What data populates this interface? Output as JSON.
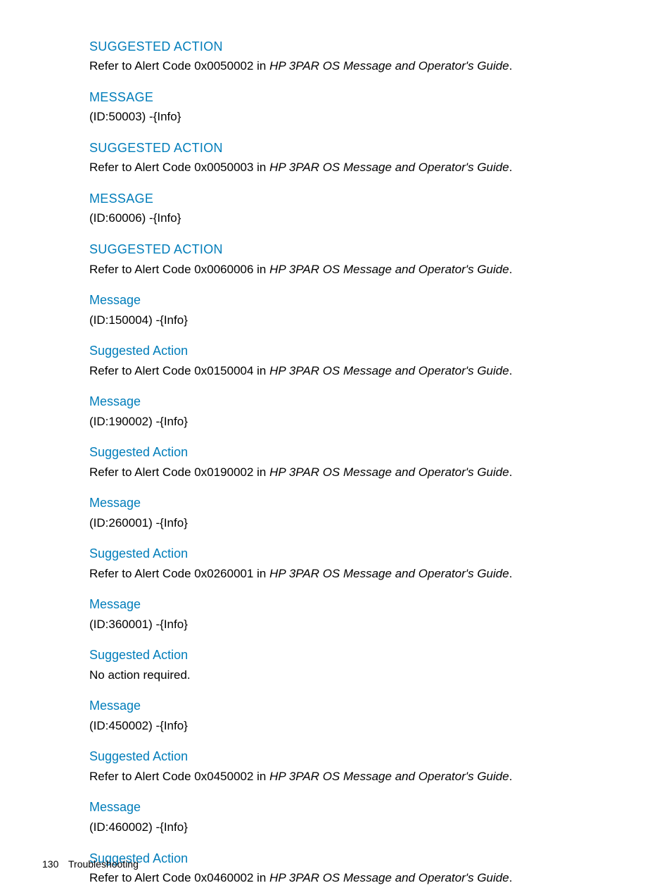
{
  "blocks": [
    {
      "heading_style": "upper",
      "heading": "Suggested Action",
      "text_pre": "Refer to Alert Code 0x0050002 in ",
      "text_em": "HP 3PAR OS Message and Operator's Guide",
      "text_post": "."
    },
    {
      "heading_style": "upper",
      "heading": "Message",
      "text_pre": "(ID:50003) -{Info}",
      "text_em": "",
      "text_post": ""
    },
    {
      "heading_style": "upper",
      "heading": "Suggested Action",
      "text_pre": "Refer to Alert Code 0x0050003 in ",
      "text_em": "HP 3PAR OS Message and Operator's Guide",
      "text_post": "."
    },
    {
      "heading_style": "upper",
      "heading": "Message",
      "text_pre": "(ID:60006) -{Info}",
      "text_em": "",
      "text_post": ""
    },
    {
      "heading_style": "upper",
      "heading": "Suggested Action",
      "text_pre": "Refer to Alert Code 0x0060006 in ",
      "text_em": "HP 3PAR OS Message and Operator's Guide",
      "text_post": "."
    },
    {
      "heading_style": "normal",
      "heading": "Message",
      "text_pre": "(ID:150004) -{Info}",
      "text_em": "",
      "text_post": ""
    },
    {
      "heading_style": "normal",
      "heading": "Suggested Action",
      "text_pre": "Refer to Alert Code 0x0150004 in ",
      "text_em": "HP 3PAR OS Message and Operator's Guide",
      "text_post": "."
    },
    {
      "heading_style": "normal",
      "heading": "Message",
      "text_pre": "(ID:190002) -{Info}",
      "text_em": "",
      "text_post": ""
    },
    {
      "heading_style": "normal",
      "heading": "Suggested Action",
      "text_pre": "Refer to Alert Code 0x0190002 in ",
      "text_em": "HP 3PAR OS Message and Operator's Guide",
      "text_post": "."
    },
    {
      "heading_style": "normal",
      "heading": "Message",
      "text_pre": "(ID:260001) -{Info}",
      "text_em": "",
      "text_post": ""
    },
    {
      "heading_style": "normal",
      "heading": "Suggested Action",
      "text_pre": "Refer to Alert Code 0x0260001 in ",
      "text_em": "HP 3PAR OS Message and Operator's Guide",
      "text_post": "."
    },
    {
      "heading_style": "normal",
      "heading": "Message",
      "text_pre": "(ID:360001) -{Info}",
      "text_em": "",
      "text_post": ""
    },
    {
      "heading_style": "normal",
      "heading": "Suggested Action",
      "text_pre": "No action required.",
      "text_em": "",
      "text_post": ""
    },
    {
      "heading_style": "normal",
      "heading": "Message",
      "text_pre": "(ID:450002) -{Info}",
      "text_em": "",
      "text_post": ""
    },
    {
      "heading_style": "normal",
      "heading": "Suggested Action",
      "text_pre": "Refer to Alert Code 0x0450002 in ",
      "text_em": "HP 3PAR OS Message and Operator's Guide",
      "text_post": "."
    },
    {
      "heading_style": "normal",
      "heading": "Message",
      "text_pre": "(ID:460002) -{Info}",
      "text_em": "",
      "text_post": ""
    },
    {
      "heading_style": "normal",
      "heading": "Suggested Action",
      "text_pre": "Refer to Alert Code 0x0460002 in ",
      "text_em": "HP 3PAR OS Message and Operator's Guide",
      "text_post": "."
    }
  ],
  "footer": {
    "page_number": "130",
    "section": "Troubleshooting"
  }
}
